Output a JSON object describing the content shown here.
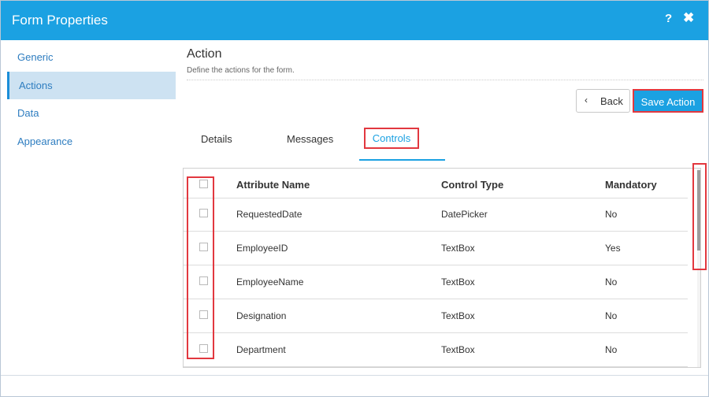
{
  "window": {
    "title": "Form Properties",
    "help_icon": "?",
    "close_icon": "✖"
  },
  "sidebar": {
    "items": [
      {
        "label": "Generic",
        "active": false
      },
      {
        "label": "Actions",
        "active": true
      },
      {
        "label": "Data",
        "active": false
      },
      {
        "label": "Appearance",
        "active": false
      }
    ]
  },
  "main": {
    "heading": "Action",
    "subheading": "Define the actions for the form.",
    "back_label": "Back",
    "back_icon": "chevron-left-icon",
    "save_label": "Save Action",
    "tabs": [
      {
        "label": "Details",
        "active": false
      },
      {
        "label": "Messages",
        "active": false
      },
      {
        "label": "Controls",
        "active": true
      }
    ]
  },
  "grid": {
    "columns": [
      "Attribute Name",
      "Control Type",
      "Mandatory"
    ],
    "rows": [
      {
        "attribute": "RequestedDate",
        "control_type": "DatePicker",
        "mandatory": "No"
      },
      {
        "attribute": "EmployeeID",
        "control_type": "TextBox",
        "mandatory": "Yes"
      },
      {
        "attribute": "EmployeeName",
        "control_type": "TextBox",
        "mandatory": "No"
      },
      {
        "attribute": "Designation",
        "control_type": "TextBox",
        "mandatory": "No"
      },
      {
        "attribute": "Department",
        "control_type": "TextBox",
        "mandatory": "No"
      }
    ]
  },
  "colors": {
    "accent": "#1ba1e2",
    "highlight": "#e2383f",
    "active_bg": "#cde2f2"
  }
}
